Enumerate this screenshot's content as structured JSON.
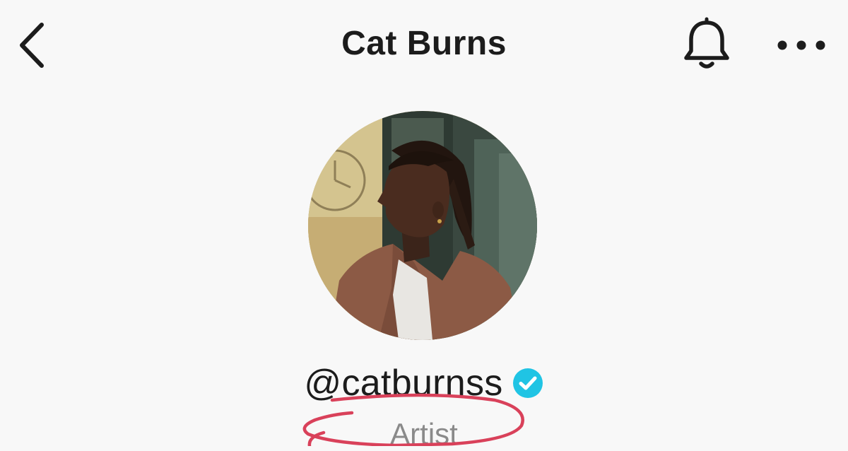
{
  "header": {
    "title": "Cat Burns"
  },
  "icons": {
    "back": "chevron-left-icon",
    "notifications": "bell-icon",
    "more": "more-horizontal-icon",
    "verified": "verified-check-icon"
  },
  "profile": {
    "handle": "@catburnss",
    "category": "Artist",
    "verified": true
  },
  "colors": {
    "verified_badge": "#20c4e4",
    "annotation_ink": "#d9415a",
    "category_text": "#8a8a8a"
  }
}
